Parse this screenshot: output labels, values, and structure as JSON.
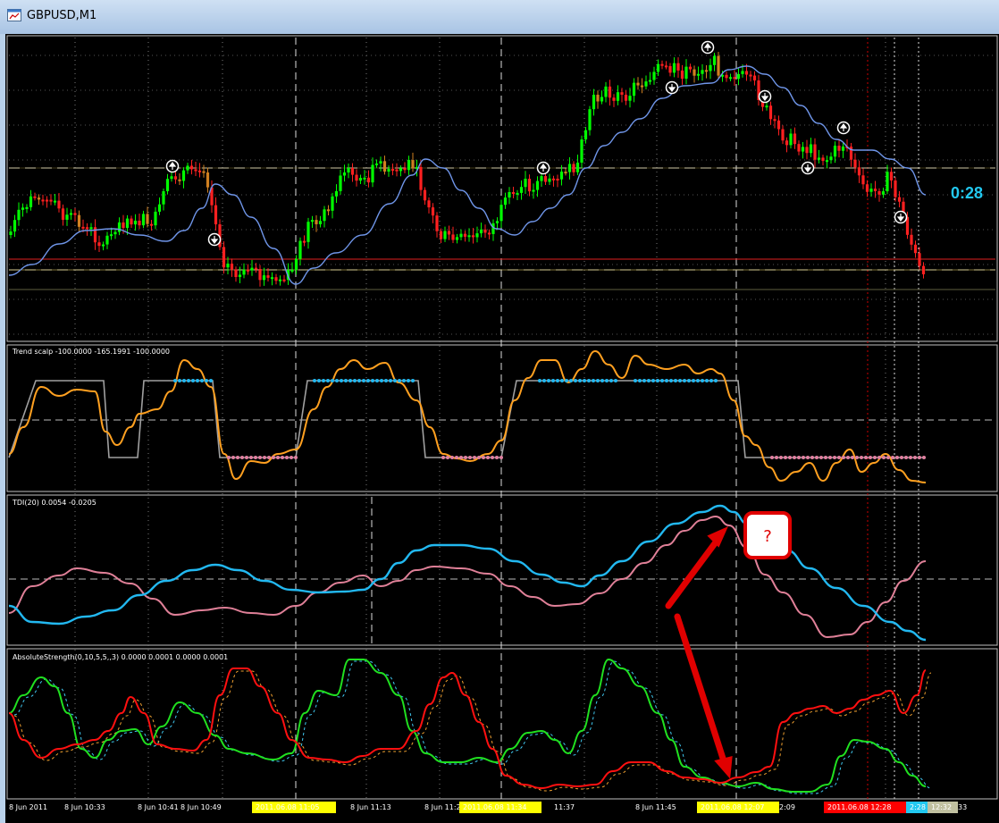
{
  "window": {
    "title": "GBPUSD,M1"
  },
  "timer": "0:28",
  "indicators": {
    "trend": "Trend scalp -100.0000 -165.1991 -100.0000",
    "tdi": "TDI(20) 0.0054 -0.0205",
    "abs": "AbsoluteStrength(0,10,5,5,,3) 0.0000 0.0001 0.0000 0.0001"
  },
  "annotation": {
    "question": "?"
  },
  "xaxis": {
    "labels": [
      "8 Jun 2011",
      "8 Jun 10:33",
      "8 Jun 10:41",
      "8 Jun 10:49",
      "11:05",
      "8 Jun 11:13",
      "8 Jun 11:21",
      "11:37",
      "8 Jun 11:45",
      "8 Jun 11:53",
      "2:09",
      "33"
    ],
    "highlights": [
      {
        "text": "2011.06.08 11:05",
        "color": "#ffff00"
      },
      {
        "text": "2011.06.08 11:34",
        "color": "#ffff00"
      },
      {
        "text": "2011.06.08 12:07",
        "color": "#ffff00"
      },
      {
        "text": "2011.06.08 12:28",
        "color": "#ff0000"
      },
      {
        "text": "2:28",
        "color": "#22c8f0"
      },
      {
        "text": "12:32",
        "color": "#c0c0a0"
      }
    ]
  },
  "colors": {
    "bull": "#00ff00",
    "bear": "#ff2020",
    "ma": "#6f95e8",
    "trend": "#ffa020",
    "tdi_blue": "#22b8f0",
    "tdi_pink": "#e08098",
    "abs_green": "#20e020",
    "abs_red": "#ff1010"
  }
}
